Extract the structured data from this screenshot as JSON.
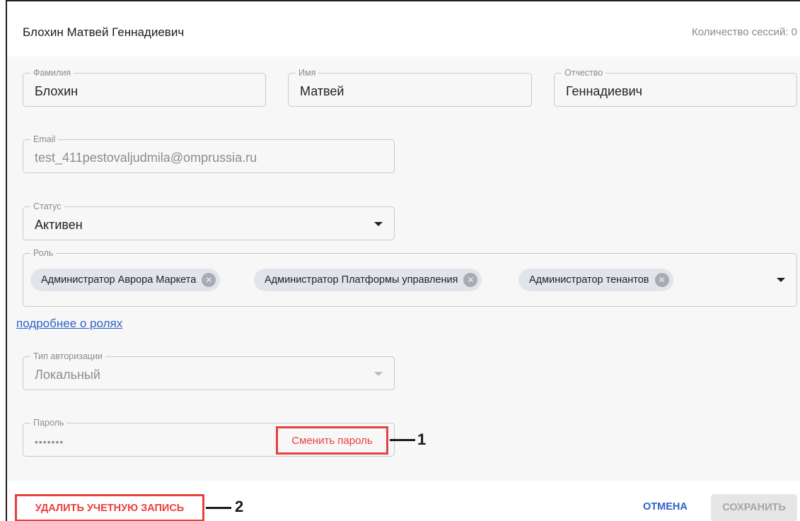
{
  "header": {
    "title": "Блохин Матвей Геннадиевич",
    "sessions": "Количество сессий: 0"
  },
  "fields": {
    "last_name": {
      "label": "Фамилия",
      "value": "Блохин"
    },
    "first_name": {
      "label": "Имя",
      "value": "Матвей"
    },
    "patronymic": {
      "label": "Отчество",
      "value": "Геннадиевич"
    },
    "email": {
      "label": "Email",
      "value": "test_411pestovaljudmila@omprussia.ru"
    },
    "status": {
      "label": "Статус",
      "value": "Активен"
    },
    "role": {
      "label": "Роль",
      "chips": [
        "Администратор Аврора Маркета",
        "Администратор Платформы управления",
        "Администратор тенантов"
      ]
    },
    "auth_type": {
      "label": "Тип авторизации",
      "value": "Локальный"
    },
    "password": {
      "label": "Пароль",
      "value": "•••••••",
      "change_label": "Сменить пароль"
    }
  },
  "roles_link": "подробнее о ролях",
  "annotations": {
    "one": "1",
    "two": "2"
  },
  "footer": {
    "delete_label": "УДАЛИТЬ УЧЕТНУЮ ЗАПИСЬ",
    "cancel_label": "ОТМЕНА",
    "save_label": "СОХРАНИТЬ"
  },
  "colors": {
    "accent": "#2f62c8",
    "highlight": "#e8403c",
    "chip_bg": "#e2e4ec"
  },
  "icons": {
    "chip_remove": "close-circle-icon",
    "dropdown": "caret-down-icon"
  }
}
